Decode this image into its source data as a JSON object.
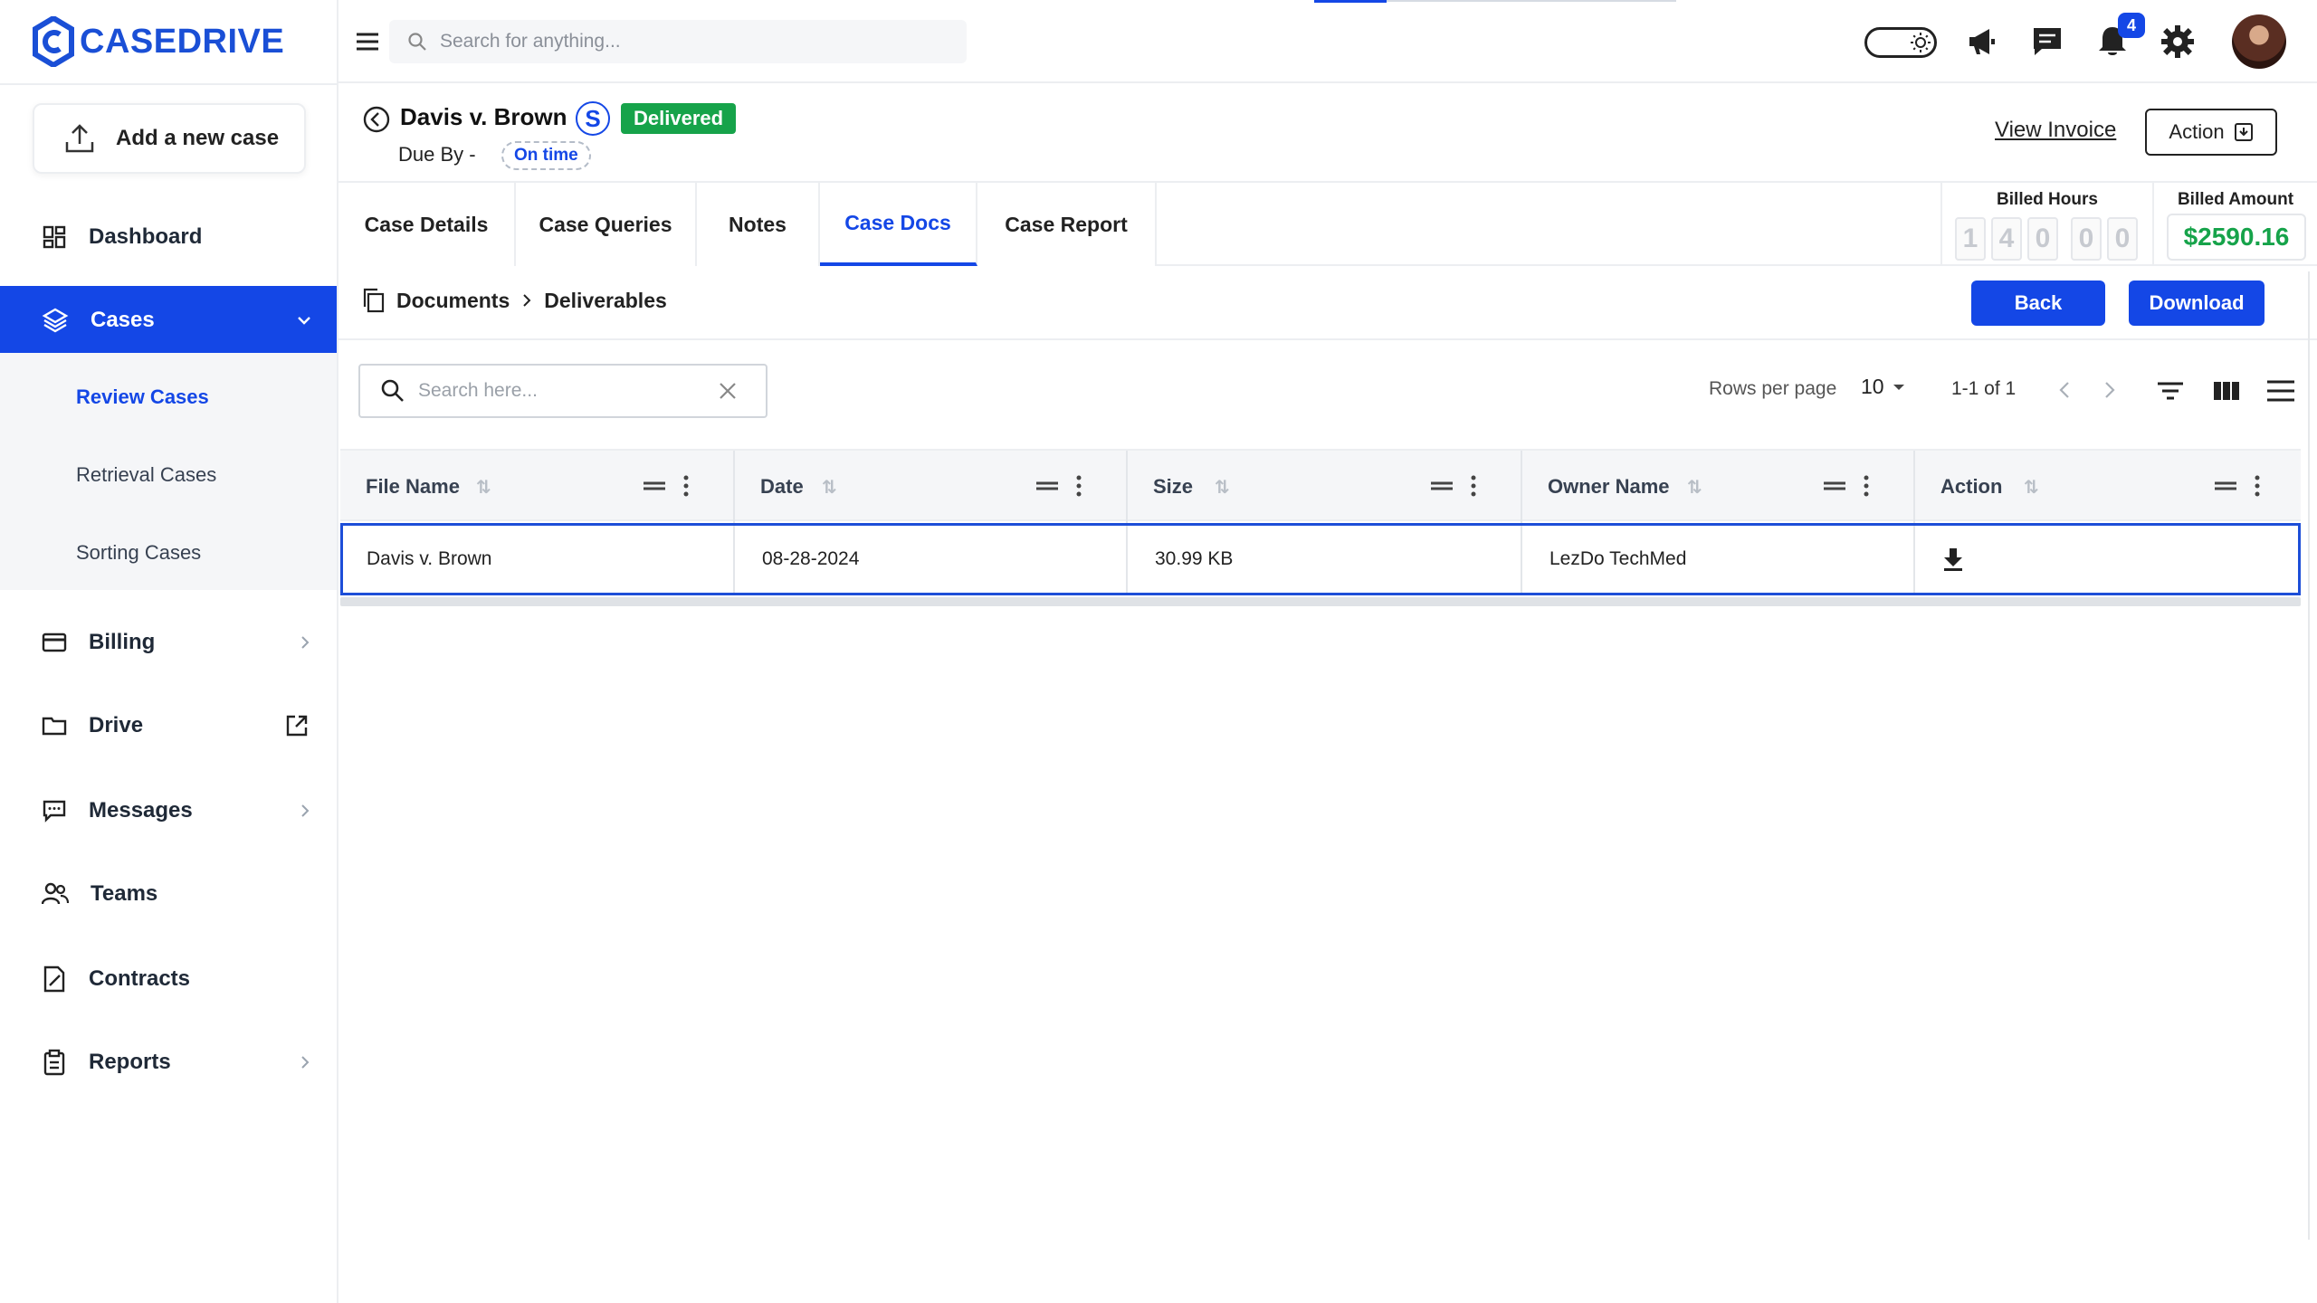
{
  "brand": {
    "name": "CASEDRIVE",
    "accent": "#1447e6"
  },
  "sidebar": {
    "add_case": "Add a new case",
    "items": [
      {
        "label": "Dashboard",
        "icon": "dashboard-icon"
      },
      {
        "label": "Cases",
        "icon": "layers-icon"
      },
      {
        "label": "Billing",
        "icon": "credit-card-icon"
      },
      {
        "label": "Drive",
        "icon": "folder-icon"
      },
      {
        "label": "Messages",
        "icon": "message-icon"
      },
      {
        "label": "Teams",
        "icon": "users-icon"
      },
      {
        "label": "Contracts",
        "icon": "contract-icon"
      },
      {
        "label": "Reports",
        "icon": "clipboard-icon"
      }
    ],
    "cases_sub": [
      "Review Cases",
      "Retrieval Cases",
      "Sorting Cases"
    ]
  },
  "topbar": {
    "search_placeholder": "Search for anything...",
    "notification_count": "4"
  },
  "case": {
    "title": "Davis v. Brown",
    "s_badge": "S",
    "status": "Delivered",
    "due_label": "Due By -",
    "due_status": "On time",
    "view_invoice": "View Invoice",
    "action_label": "Action"
  },
  "tabs": [
    "Case Details",
    "Case Queries",
    "Notes",
    "Case Docs",
    "Case Report"
  ],
  "billing": {
    "hours_label": "Billed Hours",
    "hours_digits": [
      "1",
      "4",
      "0",
      "0",
      "0"
    ],
    "amount_label": "Billed Amount",
    "amount_value": "$2590.16"
  },
  "breadcrumb": {
    "root": "Documents",
    "current": "Deliverables"
  },
  "buttons": {
    "back": "Back",
    "download": "Download"
  },
  "table_toolbar": {
    "search_placeholder": "Search here...",
    "rows_per_page_label": "Rows per page",
    "rows_per_page_value": "10",
    "page_range": "1-1 of 1"
  },
  "table": {
    "columns": [
      "File Name",
      "Date",
      "Size",
      "Owner Name",
      "Action"
    ],
    "rows": [
      {
        "file_name": "Davis v. Brown",
        "date": "08-28-2024",
        "size": "30.99 KB",
        "owner": "LezDo TechMed"
      }
    ]
  }
}
